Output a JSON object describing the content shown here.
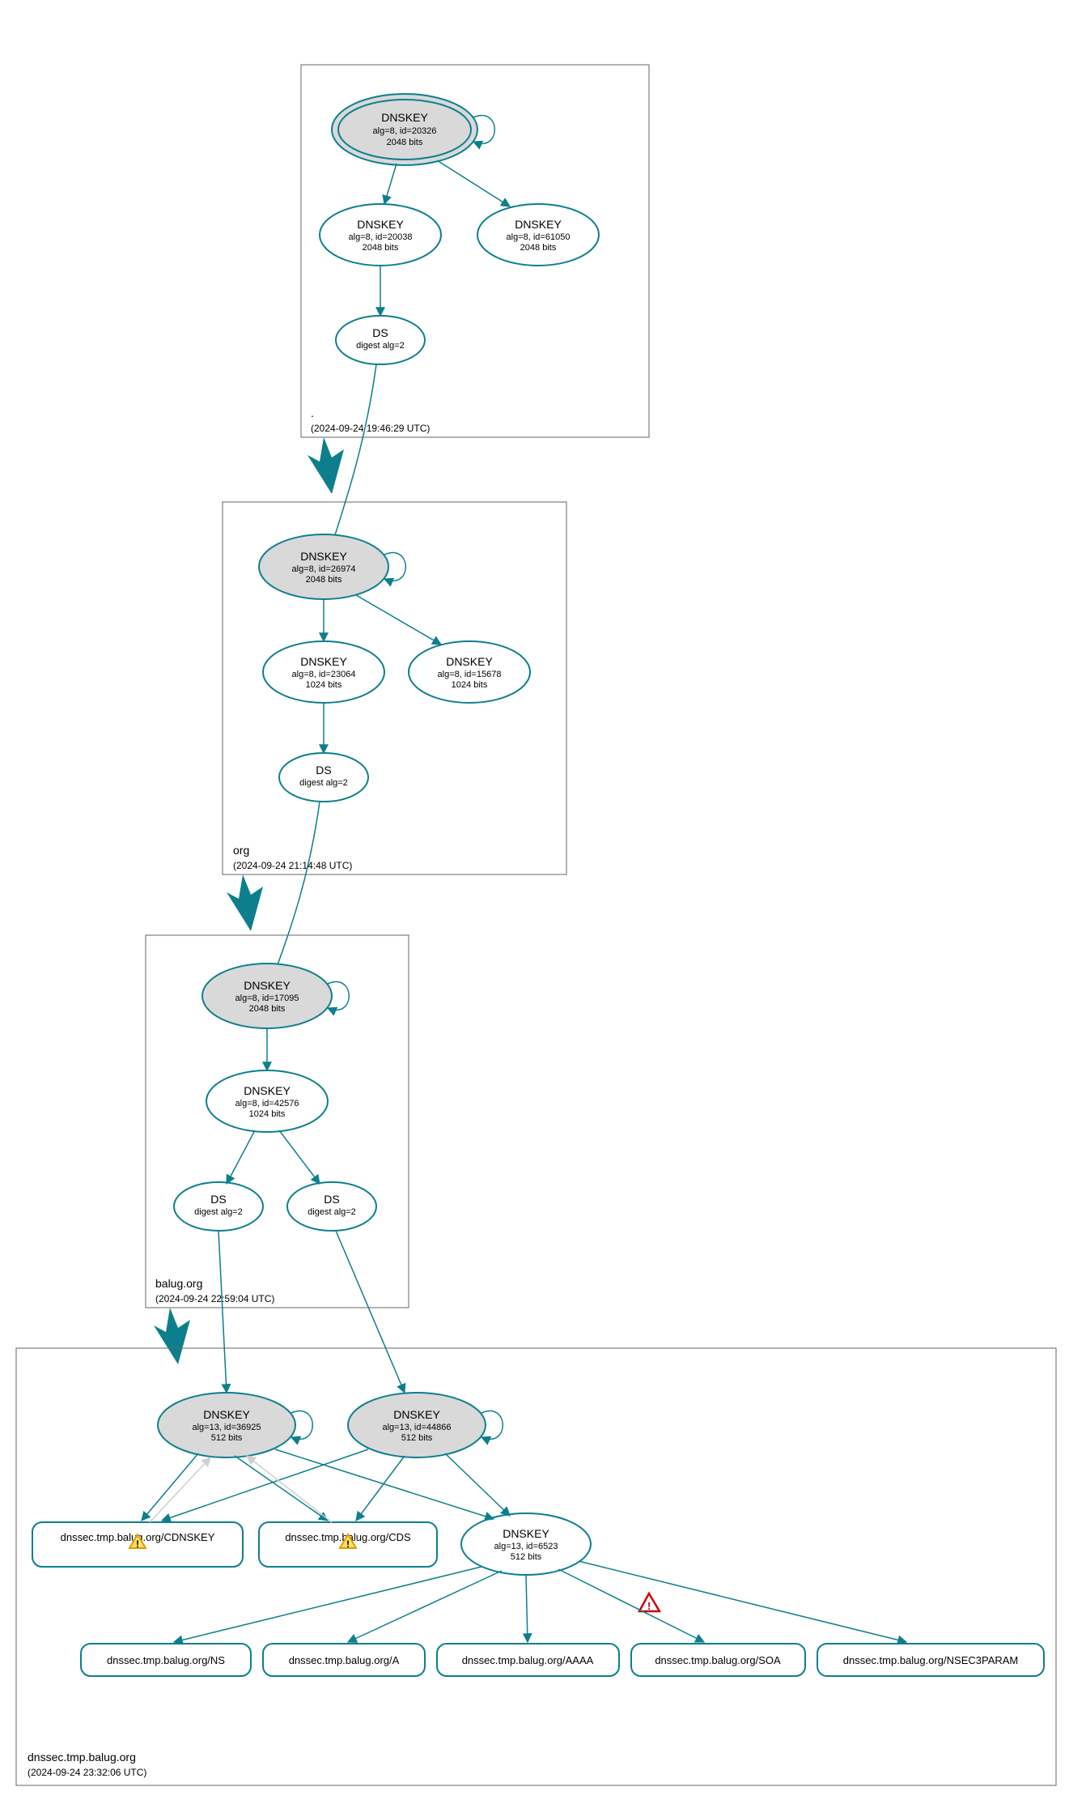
{
  "zones": {
    "root": {
      "label": ".",
      "timestamp": "(2024-09-24 19:46:29 UTC)",
      "ksk": {
        "title": "DNSKEY",
        "alg": "alg=8, id=20326",
        "bits": "2048 bits"
      },
      "zsk1": {
        "title": "DNSKEY",
        "alg": "alg=8, id=20038",
        "bits": "2048 bits"
      },
      "zsk2": {
        "title": "DNSKEY",
        "alg": "alg=8, id=61050",
        "bits": "2048 bits"
      },
      "ds": {
        "title": "DS",
        "digest": "digest alg=2"
      }
    },
    "org": {
      "label": "org",
      "timestamp": "(2024-09-24 21:14:48 UTC)",
      "ksk": {
        "title": "DNSKEY",
        "alg": "alg=8, id=26974",
        "bits": "2048 bits"
      },
      "zsk1": {
        "title": "DNSKEY",
        "alg": "alg=8, id=23064",
        "bits": "1024 bits"
      },
      "zsk2": {
        "title": "DNSKEY",
        "alg": "alg=8, id=15678",
        "bits": "1024 bits"
      },
      "ds": {
        "title": "DS",
        "digest": "digest alg=2"
      }
    },
    "balug": {
      "label": "balug.org",
      "timestamp": "(2024-09-24 22:59:04 UTC)",
      "ksk": {
        "title": "DNSKEY",
        "alg": "alg=8, id=17095",
        "bits": "2048 bits"
      },
      "zsk": {
        "title": "DNSKEY",
        "alg": "alg=8, id=42576",
        "bits": "1024 bits"
      },
      "ds1": {
        "title": "DS",
        "digest": "digest alg=2"
      },
      "ds2": {
        "title": "DS",
        "digest": "digest alg=2"
      }
    },
    "dnssec": {
      "label": "dnssec.tmp.balug.org",
      "timestamp": "(2024-09-24 23:32:06 UTC)",
      "ksk1": {
        "title": "DNSKEY",
        "alg": "alg=13, id=36925",
        "bits": "512 bits"
      },
      "ksk2": {
        "title": "DNSKEY",
        "alg": "alg=13, id=44866",
        "bits": "512 bits"
      },
      "zsk": {
        "title": "DNSKEY",
        "alg": "alg=13, id=6523",
        "bits": "512 bits"
      },
      "records": {
        "cdnskey": "dnssec.tmp.balug.org/CDNSKEY",
        "cds": "dnssec.tmp.balug.org/CDS",
        "ns": "dnssec.tmp.balug.org/NS",
        "a": "dnssec.tmp.balug.org/A",
        "aaaa": "dnssec.tmp.balug.org/AAAA",
        "soa": "dnssec.tmp.balug.org/SOA",
        "nsec3param": "dnssec.tmp.balug.org/NSEC3PARAM"
      }
    }
  }
}
